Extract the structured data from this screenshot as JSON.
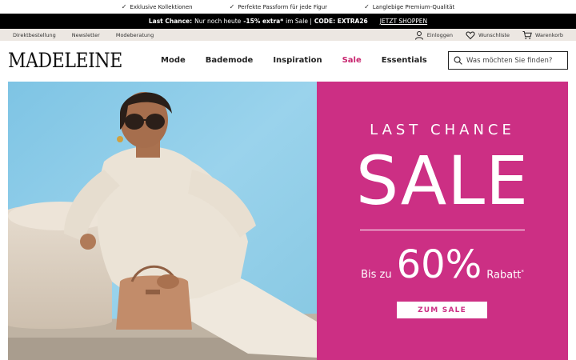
{
  "usp": [
    {
      "icon": "check-icon",
      "text": "Exklusive Kollektionen"
    },
    {
      "icon": "check-icon",
      "text": "Perfekte Passform für jede Figur"
    },
    {
      "icon": "check-icon",
      "text": "Langlebige Premium-Qualität"
    }
  ],
  "promo": {
    "prefix": "Last Chance:",
    "text1": "Nur noch heute",
    "discount": "-15% extra*",
    "text2": "im Sale |",
    "code": "CODE: EXTRA26",
    "link": "JETZT SHOPPEN"
  },
  "service": {
    "left": [
      "Direktbestellung",
      "Newsletter",
      "Modeberatung"
    ],
    "login": "Einloggen",
    "wishlist": "Wunschliste",
    "cart": "Warenkorb"
  },
  "header": {
    "logo": "MADELEINE",
    "nav": [
      "Mode",
      "Bademode",
      "Inspiration",
      "Sale",
      "Essentials"
    ],
    "search_placeholder": "Was möchten Sie finden?"
  },
  "hero": {
    "eyebrow": "LAST CHANCE",
    "title": "SALE",
    "prefix": "Bis zu",
    "percent": "60%",
    "suffix": "Rabatt",
    "asterisk": "*",
    "button": "ZUM SALE"
  },
  "colors": {
    "sale_accent": "#c8266f",
    "hero_pink": "#cc2f84",
    "service_bg": "#ece7e2",
    "promo_bg": "#000000"
  }
}
